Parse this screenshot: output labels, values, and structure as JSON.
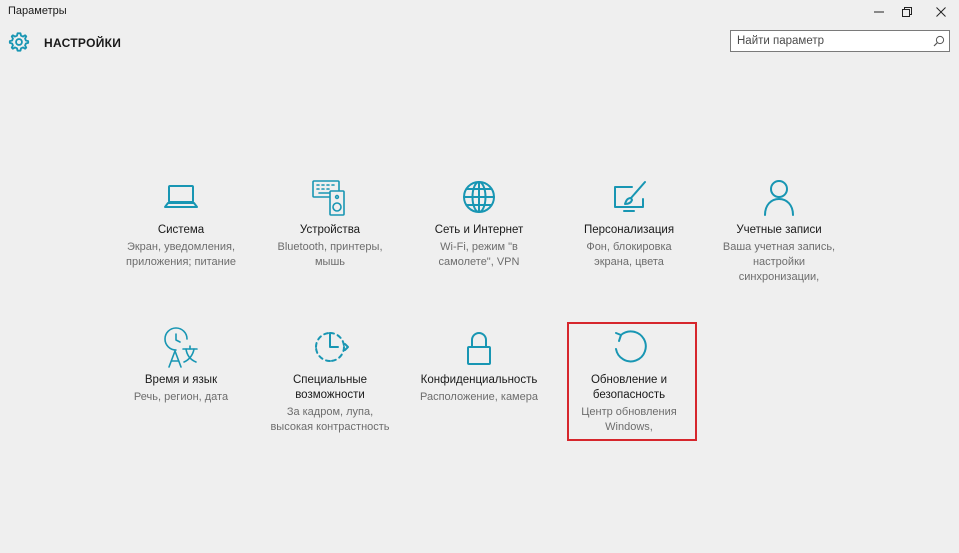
{
  "window": {
    "title": "Параметры"
  },
  "header": {
    "title": "НАСТРОЙКИ"
  },
  "search": {
    "placeholder": "Найти параметр"
  },
  "colors": {
    "accent": "#1896b3",
    "highlight": "#d6262c"
  },
  "tiles": [
    {
      "icon": "laptop-icon",
      "name": "Система",
      "desc": [
        "Экран, уведомления,",
        "приложения; питание"
      ]
    },
    {
      "icon": "keyboard-speaker-icon",
      "name": "Устройства",
      "desc": [
        "Bluetooth, принтеры,",
        "мышь"
      ]
    },
    {
      "icon": "globe-icon",
      "name": "Сеть и Интернет",
      "desc": [
        "Wi-Fi, режим \"в",
        "самолете\", VPN"
      ]
    },
    {
      "icon": "paint-monitor-icon",
      "name": "Персонализация",
      "desc": [
        "Фон, блокировка",
        "экрана, цвета"
      ]
    },
    {
      "icon": "person-icon",
      "name": "Учетные записи",
      "desc": [
        "Ваша учетная запись,",
        "настройки",
        "синхронизации,"
      ]
    },
    {
      "icon": "time-language-icon",
      "name": "Время и язык",
      "desc": [
        "Речь, регион, дата"
      ]
    },
    {
      "icon": "ease-of-access-icon",
      "name": [
        "Специальные",
        "возможности"
      ],
      "desc": [
        "За кадром, лупа,",
        "высокая контрастность"
      ]
    },
    {
      "icon": "lock-icon",
      "name": "Конфиденциальность",
      "desc": [
        "Расположение, камера"
      ]
    },
    {
      "icon": "update-arrow-icon",
      "name": [
        "Обновление и",
        "безопасность"
      ],
      "desc": [
        "Центр обновления",
        "Windows,"
      ]
    }
  ]
}
